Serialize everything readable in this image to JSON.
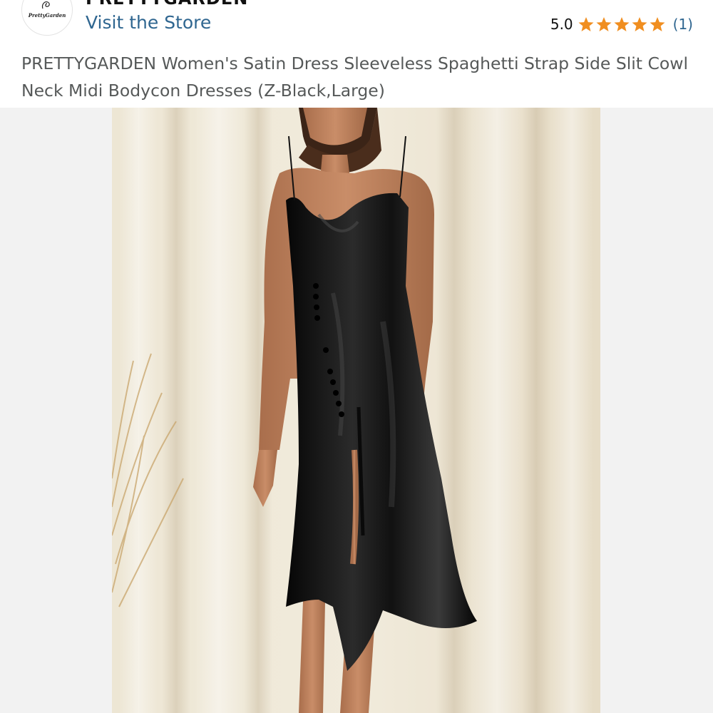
{
  "store": {
    "logo_text": "PrettyGarden",
    "brand_name": "PRETTYGARDEN",
    "visit_label": "Visit the Store"
  },
  "rating": {
    "value": "5.0",
    "stars": 5,
    "count_label": "(1)",
    "star_color": "#f08e20",
    "link_color": "#2f6690"
  },
  "product": {
    "title": "PRETTYGARDEN Women's Satin Dress Sleeveless Spaghetti Strap Side Slit Cowl Neck Midi Bodycon Dresses (Z-Black,Large)"
  },
  "colors": {
    "title_gray": "#565959",
    "gallery_bg": "#f2f2f2"
  }
}
